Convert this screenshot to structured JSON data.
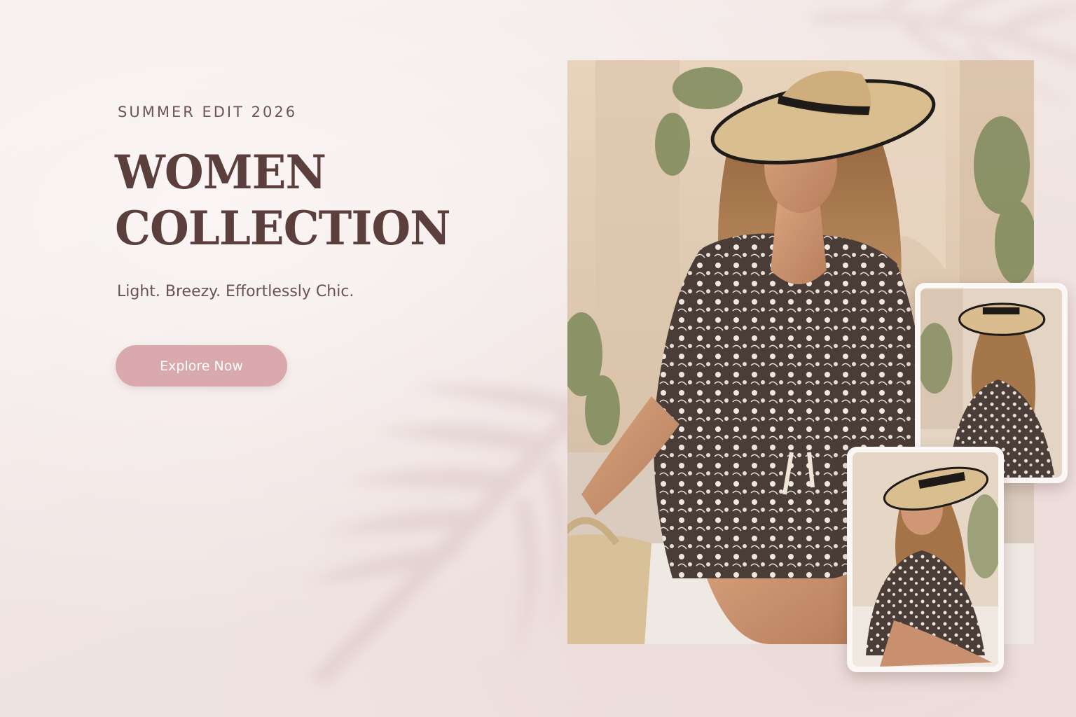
{
  "hero": {
    "eyebrow": "SUMMER EDIT 2026",
    "headline_line1": "WOMEN",
    "headline_line2": "COLLECTION",
    "tagline": "Light. Breezy. Effortlessly Chic.",
    "cta_label": "Explore Now"
  },
  "colors": {
    "background": "#f3e9e7",
    "heading": "#5a3f3d",
    "cta_background": "#d9a9ae",
    "cta_text": "#ffffff"
  },
  "images": {
    "main_photo": "woman-in-straw-hat-lace-cover-up-photo",
    "thumbnail_1": "back-view-lace-cover-up-photo",
    "thumbnail_2": "side-view-hat-lace-cover-up-photo"
  }
}
